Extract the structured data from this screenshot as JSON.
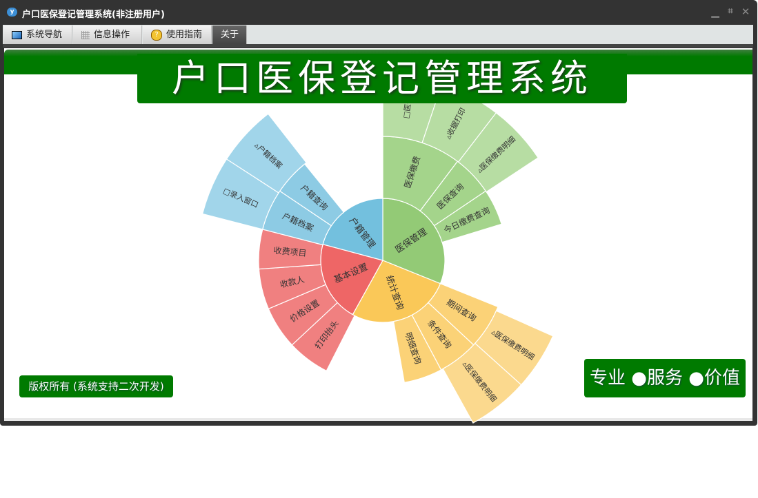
{
  "window": {
    "title": "户口医保登记管理系统(非注册用户)",
    "logo_text": "y",
    "controls": {
      "minimize": "minimize-icon",
      "restore": "restore-icon",
      "close": "close-icon"
    }
  },
  "tabs": [
    {
      "label": "系统导航",
      "icon": "monitor-icon",
      "active": false
    },
    {
      "label": "信息操作",
      "icon": "grid-icon",
      "active": false
    },
    {
      "label": "使用指南",
      "icon": "help-icon",
      "active": false
    },
    {
      "label": "关于",
      "icon": "",
      "active": true
    }
  ],
  "banner": {
    "title": "户口医保登记管理系统"
  },
  "footer": {
    "copyright": "版权所有 (系统支持二次开发)",
    "slogan": "专业 ●服务 ●价值"
  },
  "colors": {
    "brand_green": "#007a00",
    "titlebar": "#333333"
  },
  "chart_data": {
    "type": "sunburst",
    "angle_unit": "degrees",
    "rings": [
      [
        {
          "name": "医保管理",
          "start": 0,
          "end": 112,
          "color": "#93ca76"
        },
        {
          "name": "统计查询",
          "start": 112,
          "end": 209,
          "color": "#fac858"
        },
        {
          "name": "基本设置",
          "start": 209,
          "end": 285,
          "color": "#ee6666"
        },
        {
          "name": "户籍管理",
          "start": 285,
          "end": 360,
          "color": "#73c0de"
        }
      ],
      [
        {
          "name": "医保缴费",
          "start": 0,
          "end": 37,
          "color": "#a4d48b"
        },
        {
          "name": "医保查询",
          "start": 37,
          "end": 56,
          "color": "#a4d48b"
        },
        {
          "name": "今日缴费查询",
          "start": 56,
          "end": 73,
          "color": "#a4d48b"
        },
        {
          "name": "期间查询",
          "start": 112,
          "end": 133,
          "color": "#fbd277"
        },
        {
          "name": "条件查询",
          "start": 133,
          "end": 152,
          "color": "#fbd277"
        },
        {
          "name": "明细查询",
          "start": 152,
          "end": 170,
          "color": "#fbd277"
        },
        {
          "name": "打印抬头",
          "start": 207,
          "end": 227,
          "color": "#f08080"
        },
        {
          "name": "价格设置",
          "start": 227,
          "end": 247,
          "color": "#f08080"
        },
        {
          "name": "收款人",
          "start": 247,
          "end": 266,
          "color": "#f08080"
        },
        {
          "name": "收费项目",
          "start": 266,
          "end": 284.5,
          "color": "#f08080"
        },
        {
          "name": "户籍档案",
          "start": 284.5,
          "end": 304,
          "color": "#8dcbe4"
        },
        {
          "name": "户籍查询",
          "start": 304,
          "end": 321,
          "color": "#8dcbe4"
        }
      ],
      [
        {
          "name": "□医保",
          "start": 0,
          "end": 18.5,
          "color": "#b7dda3"
        },
        {
          "name": "▵收据打印",
          "start": 18.5,
          "end": 37.5,
          "color": "#b7dda3"
        },
        {
          "name": "▵医保缴费明细",
          "start": 37.5,
          "end": 56.5,
          "color": "#b7dda3"
        },
        {
          "name": "▵医保缴费明细",
          "start": 114,
          "end": 132,
          "color": "#fbd98e"
        },
        {
          "name": "▵医保缴费明细",
          "start": 132,
          "end": 151,
          "color": "#fbd98e"
        },
        {
          "name": "□录入窗口",
          "start": 284.5,
          "end": 303,
          "color": "#a1d5ea"
        },
        {
          "name": "▵户籍档案",
          "start": 303,
          "end": 322,
          "color": "#a1d5ea"
        }
      ]
    ]
  }
}
